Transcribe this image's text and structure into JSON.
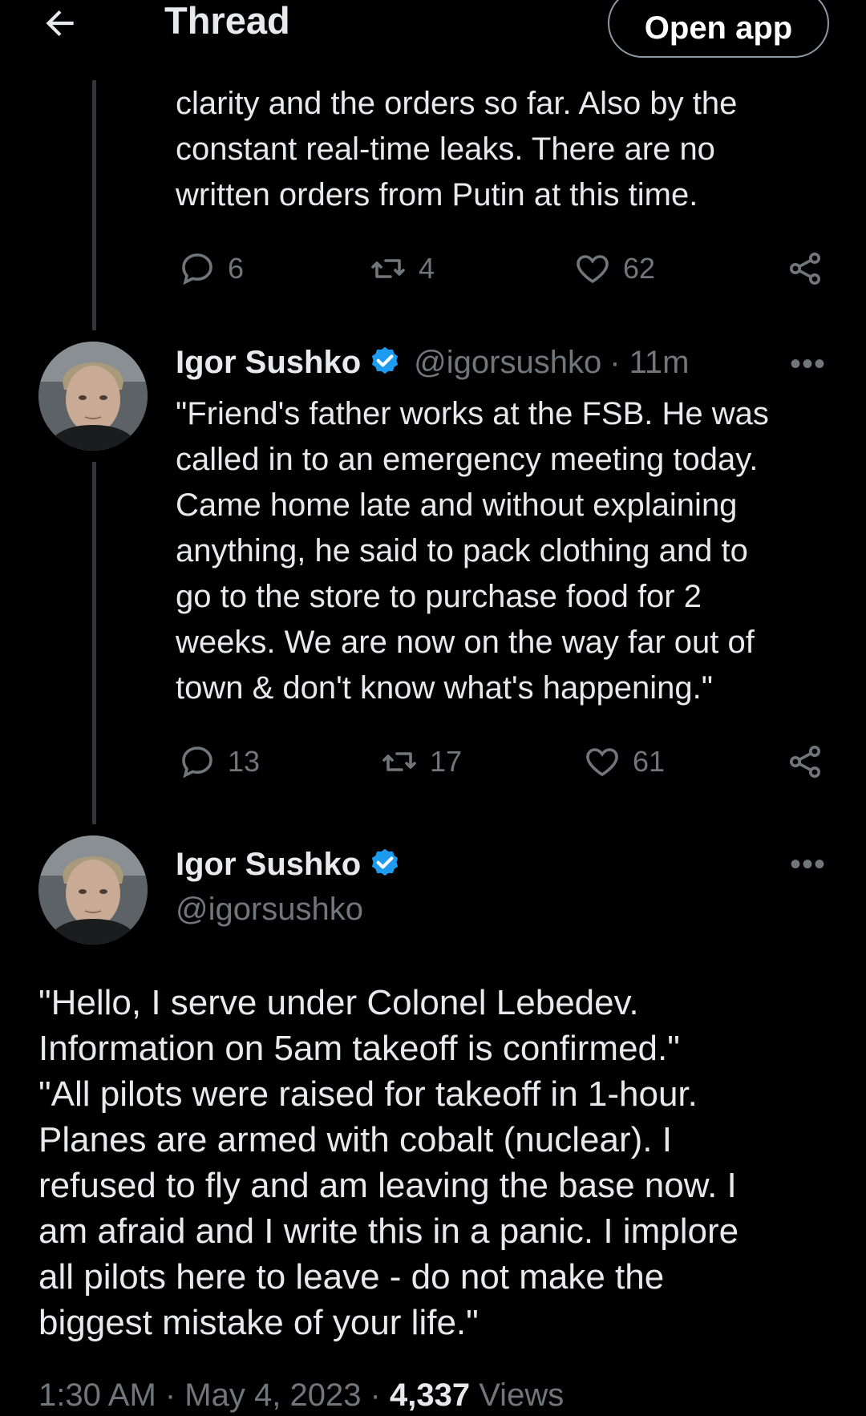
{
  "header": {
    "title": "Thread",
    "open_app": "Open app"
  },
  "tweet_prev": {
    "text": "clarity and the orders so far. Also by the\nconstant real-time leaks. There are no\nwritten orders from Putin at this time.",
    "replies": "6",
    "retweets": "4",
    "likes": "62"
  },
  "tweet_mid": {
    "name": "Igor Sushko",
    "handle": "@igorsushko",
    "time": "· 11m",
    "text": "\"Friend's father works at the FSB. He was\ncalled in to an emergency meeting today.\nCame home late and without explaining\nanything, he said to pack clothing and to\ngo to the store to purchase food for 2\nweeks. We are now on the way far out of\ntown & don't know what's happening.\"",
    "replies": "13",
    "retweets": "17",
    "likes": "61"
  },
  "tweet_main": {
    "name": "Igor Sushko",
    "handle": "@igorsushko",
    "text": "\"Hello, I serve under Colonel Lebedev.\nInformation on 5am takeoff is confirmed.\"\n\"All pilots were raised for takeoff in 1-hour.\nPlanes are armed with cobalt (nuclear). I\nrefused to fly and am leaving the base now. I\nam afraid and I write this in a panic. I implore\nall pilots here to leave - do not make the\nbiggest mistake of your life.\"",
    "time": "1:30 AM · May 4, 2023 · ",
    "views_count": "4,337",
    "views_label": " Views"
  },
  "colors": {
    "background": "#000000",
    "text": "#e7e9ea",
    "muted": "#71767b",
    "verified": "#1d9bf0"
  }
}
